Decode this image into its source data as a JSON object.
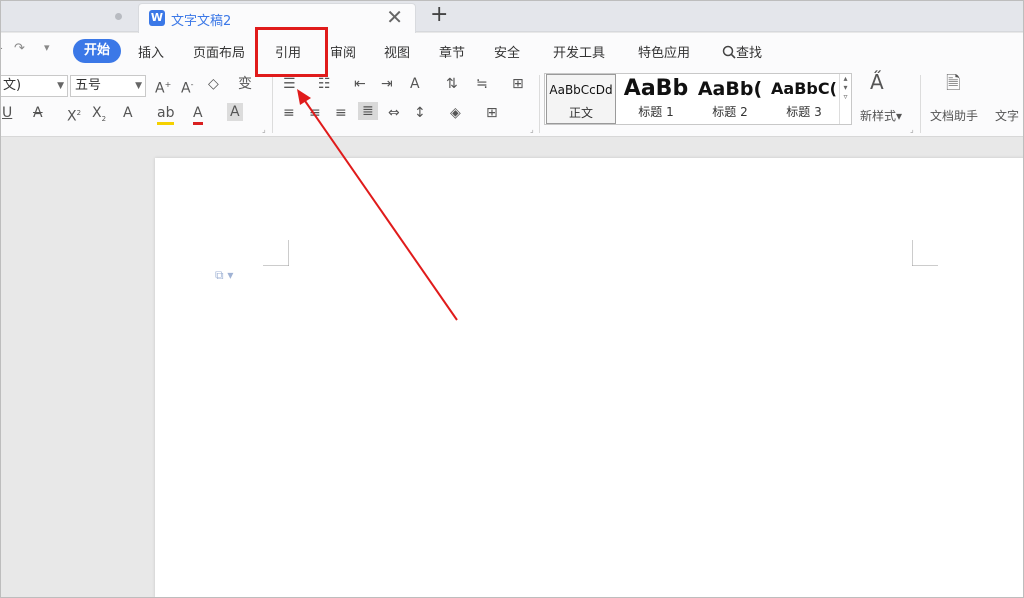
{
  "tabs": {
    "inactive_title": "",
    "active_title": "文字文稿2",
    "active_icon_letter": "W",
    "close_symbol": "✕",
    "new_tab_symbol": "+"
  },
  "quick_access": {
    "undo": "↶",
    "redo": "↷",
    "more": "▾"
  },
  "menu": {
    "start": "开始",
    "items": [
      "插入",
      "页面布局",
      "引用",
      "审阅",
      "视图",
      "章节",
      "安全",
      "开发工具",
      "特色应用"
    ],
    "search_label": "查找",
    "search_icon": "search-icon",
    "highlighted_item": "引用",
    "highlight_color": "#e01b1b"
  },
  "ribbon": {
    "font_name_partial": "文)",
    "font_size": "五号",
    "styles": [
      {
        "sample": "AaBbCcDd",
        "label": "正文"
      },
      {
        "sample": "AaBb",
        "label": "标题 1"
      },
      {
        "sample": "AaBb(",
        "label": "标题 2"
      },
      {
        "sample": "AaBbC(",
        "label": "标题 3"
      }
    ],
    "new_style_label": "新样式",
    "doc_assistant_label": "文档助手",
    "text_tools_label": "文字"
  },
  "colors": {
    "accent": "#3b78e7",
    "arrow": "#e01b1b",
    "page": "#ffffff",
    "workspace": "#e8e8e8"
  }
}
